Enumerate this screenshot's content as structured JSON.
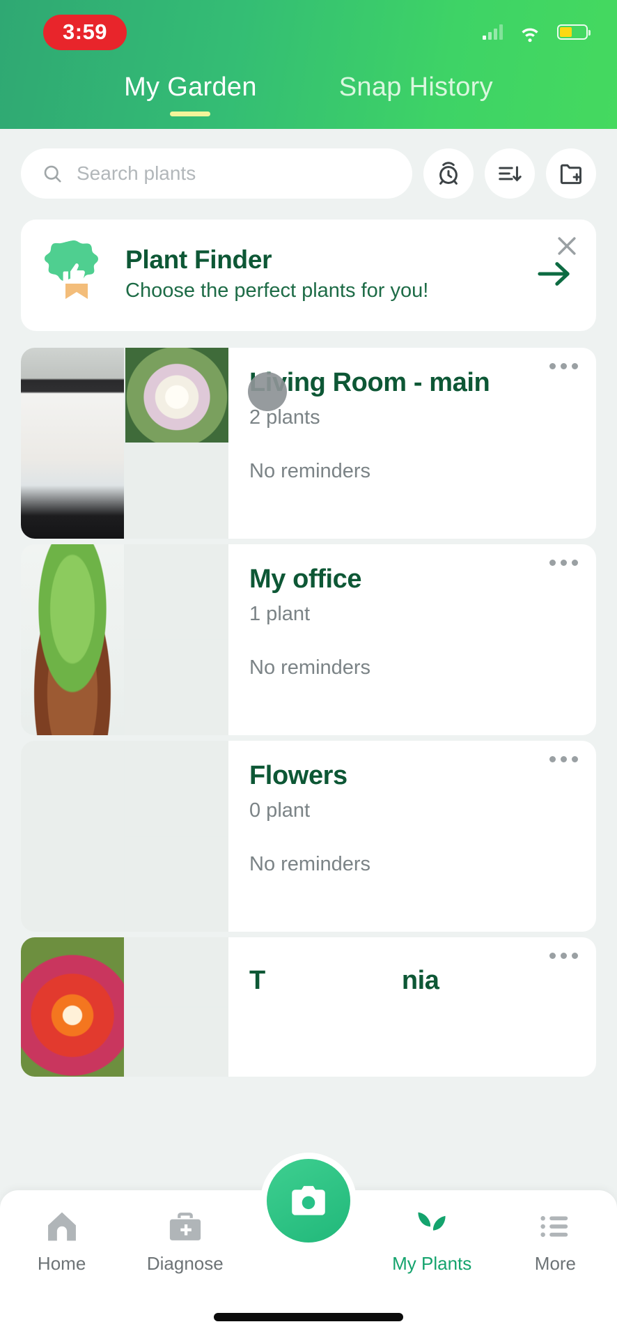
{
  "status_bar": {
    "time": "3:59",
    "signal_icon": "cellular-signal-icon",
    "wifi_icon": "wifi-icon",
    "battery_icon": "battery-icon"
  },
  "header": {
    "tabs": [
      {
        "label": "My Garden",
        "active": true
      },
      {
        "label": "Snap History",
        "active": false
      }
    ]
  },
  "search": {
    "placeholder": "Search plants",
    "icon": "search-icon",
    "actions": [
      {
        "name": "reminders-alarm-button",
        "icon": "alarm-clock-icon"
      },
      {
        "name": "sort-button",
        "icon": "sort-descending-icon"
      },
      {
        "name": "add-folder-button",
        "icon": "folder-plus-icon"
      }
    ]
  },
  "banner": {
    "icon": "thumbs-up-badge-icon",
    "title": "Plant Finder",
    "subtitle": "Choose the perfect plants for you!",
    "arrow_icon": "arrow-right-icon",
    "close_icon": "close-icon"
  },
  "gardens": [
    {
      "title": "Living Room - main",
      "count": "2 plants",
      "reminders": "No reminders",
      "menu_icon": "more-options-icon",
      "thumbs": [
        "ph-laptop",
        "ph-lily",
        "",
        ""
      ]
    },
    {
      "title": "My office",
      "count": "1 plant",
      "reminders": "No reminders",
      "menu_icon": "more-options-icon",
      "thumbs": [
        "ph-spider",
        "",
        "",
        ""
      ]
    },
    {
      "title": "Flowers",
      "count": "0 plant",
      "reminders": "No reminders",
      "menu_icon": "more-options-icon",
      "thumbs": [
        "",
        "",
        "",
        ""
      ]
    }
  ],
  "partial_card": {
    "title_left": "T",
    "title_right": "nia",
    "menu_icon": "more-options-icon",
    "thumb": "ph-orchid"
  },
  "bottom_nav": {
    "items": [
      {
        "label": "Home",
        "icon": "home-icon",
        "active": false
      },
      {
        "label": "Diagnose",
        "icon": "medical-bag-plus-icon",
        "active": false
      },
      {
        "label": "My Plants",
        "icon": "sprout-icon",
        "active": true
      },
      {
        "label": "More",
        "icon": "list-menu-icon",
        "active": false
      }
    ],
    "fab": {
      "name": "camera-capture-button",
      "icon": "camera-icon"
    }
  },
  "colors": {
    "brand_green": "#14a36d",
    "header_gradient_start": "#2fa873",
    "header_gradient_end": "#45d95f",
    "title_green": "#0d5735",
    "clock_red": "#e8252b",
    "underline_yellow": "#f4f49a"
  }
}
